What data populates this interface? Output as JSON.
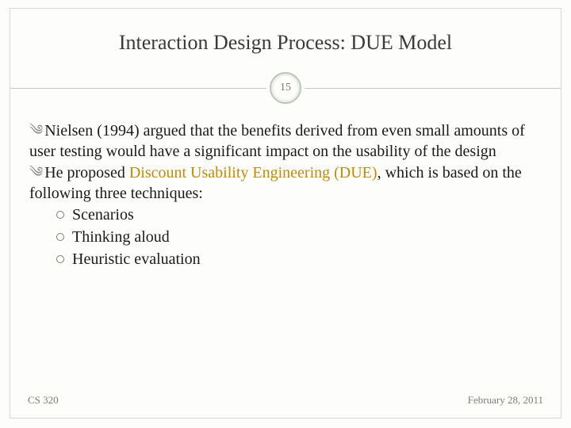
{
  "title": "Interaction Design Process: DUE Model",
  "page_number": "15",
  "bullets": [
    {
      "prefix": "Nielsen (1994) ",
      "rest": "argued that the benefits derived from even small amounts of user testing would have a significant impact on the usability of the design"
    },
    {
      "prefix": "He proposed ",
      "accent": "Discount Usability Engineering (DUE)",
      "rest": ", which is based on the following three techniques:"
    }
  ],
  "sub_bullets": [
    "Scenarios",
    "Thinking aloud",
    "Heuristic evaluation"
  ],
  "footer": {
    "left": "CS 320",
    "right": "February 28, 2011"
  }
}
